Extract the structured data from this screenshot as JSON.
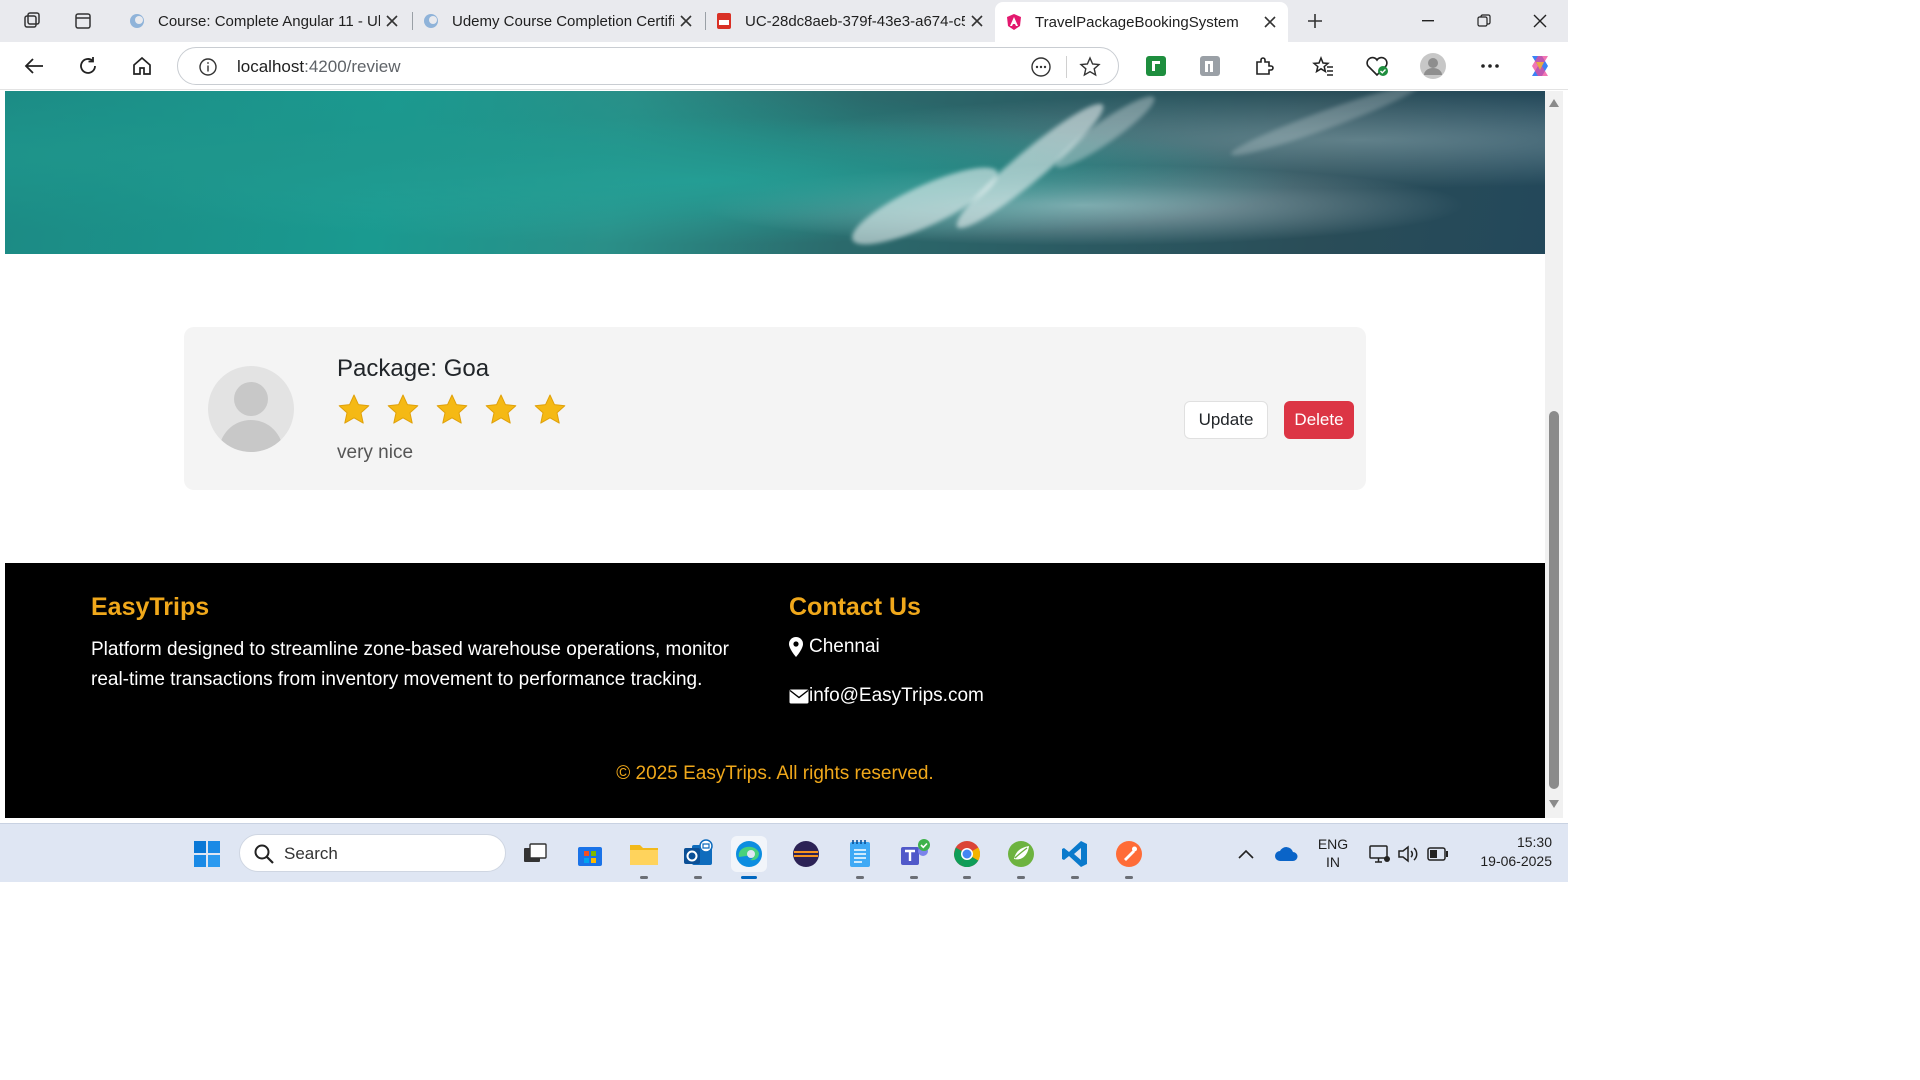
{
  "browser": {
    "tabs": [
      {
        "title": "Course: Complete Angular 11 - Ul",
        "active": false
      },
      {
        "title": "Udemy Course Completion Certifi",
        "active": false
      },
      {
        "title": "UC-28dc8aeb-379f-43e3-a674-c5",
        "active": false
      },
      {
        "title": "TravelPackageBookingSystem",
        "active": true
      }
    ],
    "url_host": "localhost",
    "url_path": ":4200/review"
  },
  "review": {
    "package_title": "Package: Goa",
    "rating": 5,
    "rating_max": 5,
    "comment": "very nice",
    "update_label": "Update",
    "delete_label": "Delete"
  },
  "footer": {
    "brand": "EasyTrips",
    "description": "Platform designed to streamline zone-based warehouse operations, monitor real-time transactions from inventory movement to performance tracking.",
    "contact_heading": "Contact Us",
    "location": "Chennai",
    "email": "info@EasyTrips.com",
    "copyright": "© 2025 EasyTrips. All rights reserved."
  },
  "taskbar": {
    "search_placeholder": "Search",
    "lang_line1": "ENG",
    "lang_line2": "IN",
    "time": "15:30",
    "date": "19-06-2025"
  },
  "colors": {
    "accent": "#f0a81b",
    "delete": "#dc3545",
    "star": "#f5b914",
    "footer_bg": "#000000"
  }
}
